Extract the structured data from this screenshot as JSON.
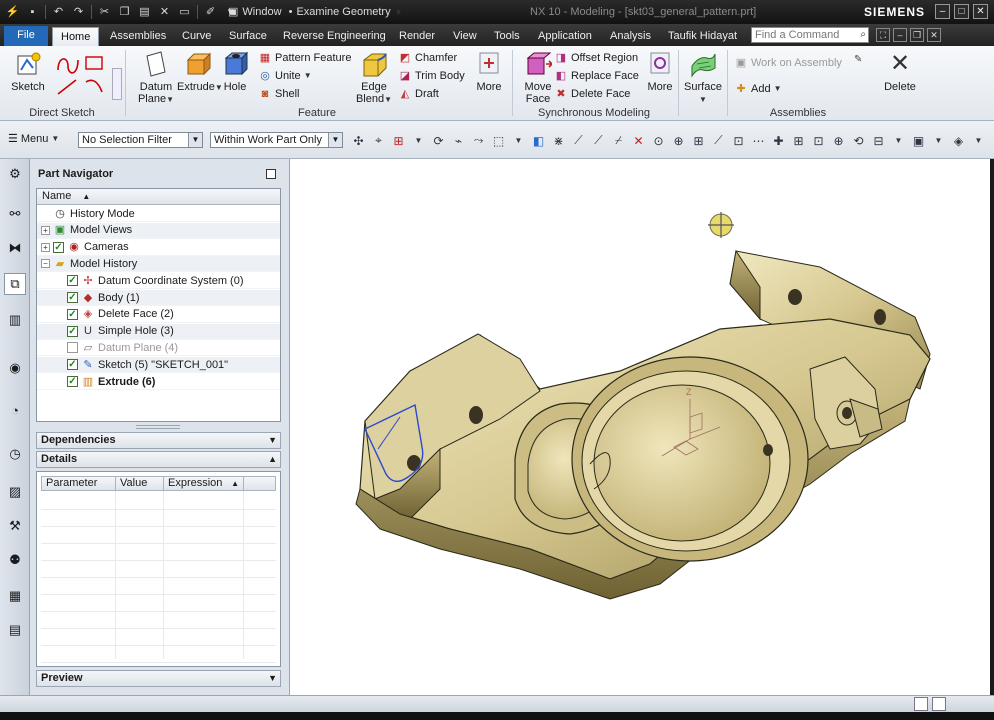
{
  "titlebar": {
    "window_menu": "Window",
    "application_mode": "Examine Geometry",
    "title": "NX 10 - Modeling - [skt03_general_pattern.prt]",
    "brand": "SIEMENS"
  },
  "tabs": [
    {
      "label": "File"
    },
    {
      "label": "Home"
    },
    {
      "label": "Assemblies"
    },
    {
      "label": "Curve"
    },
    {
      "label": "Surface"
    },
    {
      "label": "Reverse Engineering"
    },
    {
      "label": "Render"
    },
    {
      "label": "View"
    },
    {
      "label": "Tools"
    },
    {
      "label": "Application"
    },
    {
      "label": "Analysis"
    },
    {
      "label": "Taufik Hidayat"
    }
  ],
  "search": {
    "placeholder": "Find a Command"
  },
  "ribbon": {
    "direct_sketch": {
      "label": "Direct Sketch",
      "sketch": "Sketch"
    },
    "feature": {
      "label": "Feature",
      "datum_plane": "Datum Plane",
      "extrude": "Extrude",
      "hole": "Hole",
      "pattern_feature": "Pattern Feature",
      "unite": "Unite",
      "shell": "Shell",
      "edge_blend": "Edge Blend",
      "chamfer": "Chamfer",
      "trim_body": "Trim Body",
      "draft": "Draft",
      "more": "More"
    },
    "sync": {
      "label": "Synchronous Modeling",
      "move_face": "Move Face",
      "offset_region": "Offset Region",
      "replace_face": "Replace Face",
      "delete_face": "Delete Face",
      "more": "More"
    },
    "surface": {
      "label": "Surface"
    },
    "assemblies": {
      "label": "Assemblies",
      "work_on_assembly": "Work on Assembly",
      "add": "Add",
      "delete": "Delete"
    }
  },
  "cmdbar": {
    "menu": "Menu",
    "selection_filter": "No Selection Filter",
    "scope": "Within Work Part Only"
  },
  "navigator": {
    "title": "Part Navigator",
    "column_name": "Name",
    "rows": [
      {
        "label": "History Mode",
        "indent": 0,
        "expander": "",
        "check": false,
        "icon": "clock-icon",
        "glyph": "◷",
        "color": "#333333",
        "bold": false,
        "dim": false
      },
      {
        "label": "Model Views",
        "indent": 0,
        "expander": "+",
        "check": false,
        "icon": "model-views-icon",
        "glyph": "▣",
        "color": "#2f8a2f",
        "bold": false,
        "dim": false
      },
      {
        "label": "Cameras",
        "indent": 0,
        "expander": "+",
        "check": true,
        "icon": "camera-icon",
        "glyph": "◉",
        "color": "#b02020",
        "bold": false,
        "dim": false
      },
      {
        "label": "Model History",
        "indent": 0,
        "expander": "−",
        "check": false,
        "icon": "folder-icon",
        "glyph": "▰",
        "color": "#d6a420",
        "bold": false,
        "dim": false
      },
      {
        "label": "Datum Coordinate System (0)",
        "indent": 1,
        "expander": "",
        "check": true,
        "icon": "datum-csys-icon",
        "glyph": "✢",
        "color": "#c23030",
        "bold": false,
        "dim": false
      },
      {
        "label": "Body (1)",
        "indent": 1,
        "expander": "",
        "check": true,
        "icon": "body-icon",
        "glyph": "◆",
        "color": "#b03030",
        "bold": false,
        "dim": false
      },
      {
        "label": "Delete Face (2)",
        "indent": 1,
        "expander": "",
        "check": true,
        "icon": "delete-face-icon",
        "glyph": "◈",
        "color": "#c04040",
        "bold": false,
        "dim": false
      },
      {
        "label": "Simple Hole (3)",
        "indent": 1,
        "expander": "",
        "check": true,
        "icon": "hole-icon",
        "glyph": "U",
        "color": "#333333",
        "bold": false,
        "dim": false
      },
      {
        "label": "Datum Plane (4)",
        "indent": 1,
        "expander": "",
        "check": false,
        "icon": "datum-plane-icon",
        "glyph": "▱",
        "color": "#777777",
        "bold": false,
        "dim": true
      },
      {
        "label": "Sketch (5) \"SKETCH_001\"",
        "indent": 1,
        "expander": "",
        "check": true,
        "icon": "sketch-icon",
        "glyph": "✎",
        "color": "#3060c0",
        "bold": false,
        "dim": false
      },
      {
        "label": "Extrude (6)",
        "indent": 1,
        "expander": "",
        "check": true,
        "icon": "extrude-icon",
        "glyph": "▥",
        "color": "#d08020",
        "bold": true,
        "dim": false
      }
    ],
    "dependencies": "Dependencies",
    "details": "Details",
    "details_columns": [
      "Parameter",
      "Value",
      "Expression"
    ],
    "preview": "Preview"
  },
  "colors": {
    "part_fill": "#d9cc9a",
    "part_shadow": "#8a7a45",
    "accent_blue": "#2468b8"
  }
}
